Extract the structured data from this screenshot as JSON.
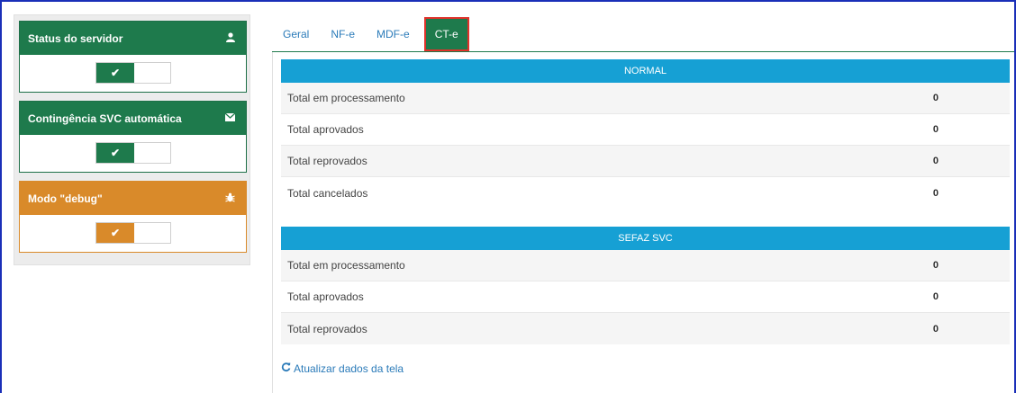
{
  "sidebar": {
    "cards": [
      {
        "title": "Status do servidor",
        "icon": "user-icon",
        "toggle_check": "✔"
      },
      {
        "title": "Contingência SVC automática",
        "icon": "envelope-icon",
        "toggle_check": "✔"
      },
      {
        "title": "Modo \"debug\"",
        "icon": "bug-icon",
        "toggle_check": "✔"
      }
    ]
  },
  "tabs": [
    "Geral",
    "NF-e",
    "MDF-e",
    "CT-e"
  ],
  "active_tab": "CT-e",
  "sections": [
    {
      "title": "NORMAL",
      "rows": [
        {
          "label": "Total em processamento",
          "value": "0"
        },
        {
          "label": "Total aprovados",
          "value": "0"
        },
        {
          "label": "Total reprovados",
          "value": "0"
        },
        {
          "label": "Total cancelados",
          "value": "0"
        }
      ]
    },
    {
      "title": "SEFAZ SVC",
      "rows": [
        {
          "label": "Total em processamento",
          "value": "0"
        },
        {
          "label": "Total aprovados",
          "value": "0"
        },
        {
          "label": "Total reprovados",
          "value": "0"
        }
      ]
    }
  ],
  "refresh_label": "Atualizar dados da tela",
  "colors": {
    "green": "#1e7a4c",
    "orange": "#d98a2a",
    "section_blue": "#16a0d4",
    "link_blue": "#2b7bb9",
    "active_tab_outline": "#e0322a"
  }
}
